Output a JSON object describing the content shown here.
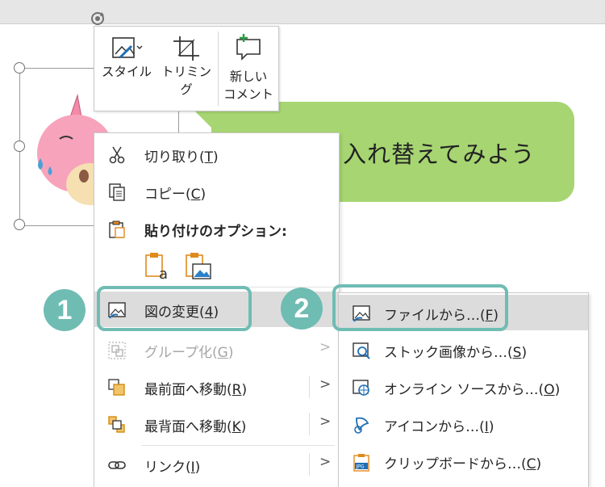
{
  "slide": {
    "bubble_text": "入れ替えてみよう"
  },
  "mini_toolbar": {
    "style_label": "スタイル",
    "trim_label": "トリミング",
    "comment_label_line1": "新しい",
    "comment_label_line2": "コメント"
  },
  "context_menu": {
    "items": [
      {
        "label": "切り取り(",
        "key": "T",
        "close": ")",
        "icon": "scissors-icon"
      },
      {
        "label": "コピー(",
        "key": "C",
        "close": ")",
        "icon": "copy-icon"
      },
      {
        "label": "貼り付けのオプション:",
        "icon": "paste-icon"
      },
      {
        "label": "図の変更(",
        "key": "4",
        "close": ")",
        "icon": "change-picture-icon"
      },
      {
        "label": "グループ化(",
        "key": "G",
        "close": ")",
        "icon": "group-icon",
        "disabled": true
      },
      {
        "label": "最前面へ移動(",
        "key": "R",
        "close": ")",
        "icon": "bring-to-front-icon"
      },
      {
        "label": "最背面へ移動(",
        "key": "K",
        "close": ")",
        "icon": "send-to-back-icon"
      },
      {
        "label": "リンク(",
        "key": "I",
        "close": ")",
        "icon": "link-icon"
      }
    ],
    "paste_options": [
      "paste-keep-text-icon",
      "paste-picture-icon"
    ],
    "submenu_arrow": ">"
  },
  "submenu": {
    "items": [
      {
        "label": "ファイルから…(",
        "key": "F",
        "close": ")",
        "icon": "from-file-icon"
      },
      {
        "label": "ストック画像から…(",
        "key": "S",
        "close": ")",
        "icon": "stock-images-icon"
      },
      {
        "label": "オンライン ソースから…(",
        "key": "O",
        "close": ")",
        "icon": "online-source-icon"
      },
      {
        "label": "アイコンから…(",
        "key": "I",
        "close": ")",
        "icon": "from-icons-icon"
      },
      {
        "label": "クリップボードから…(",
        "key": "C",
        "close": ")",
        "icon": "from-clipboard-icon"
      }
    ]
  },
  "callouts": {
    "step1": "1",
    "step2": "2",
    "color": "#6fbcb3"
  },
  "colors": {
    "bubble": "#a6d572",
    "highlight": "#dcdcdc",
    "pink_character": "#f28aa8"
  }
}
